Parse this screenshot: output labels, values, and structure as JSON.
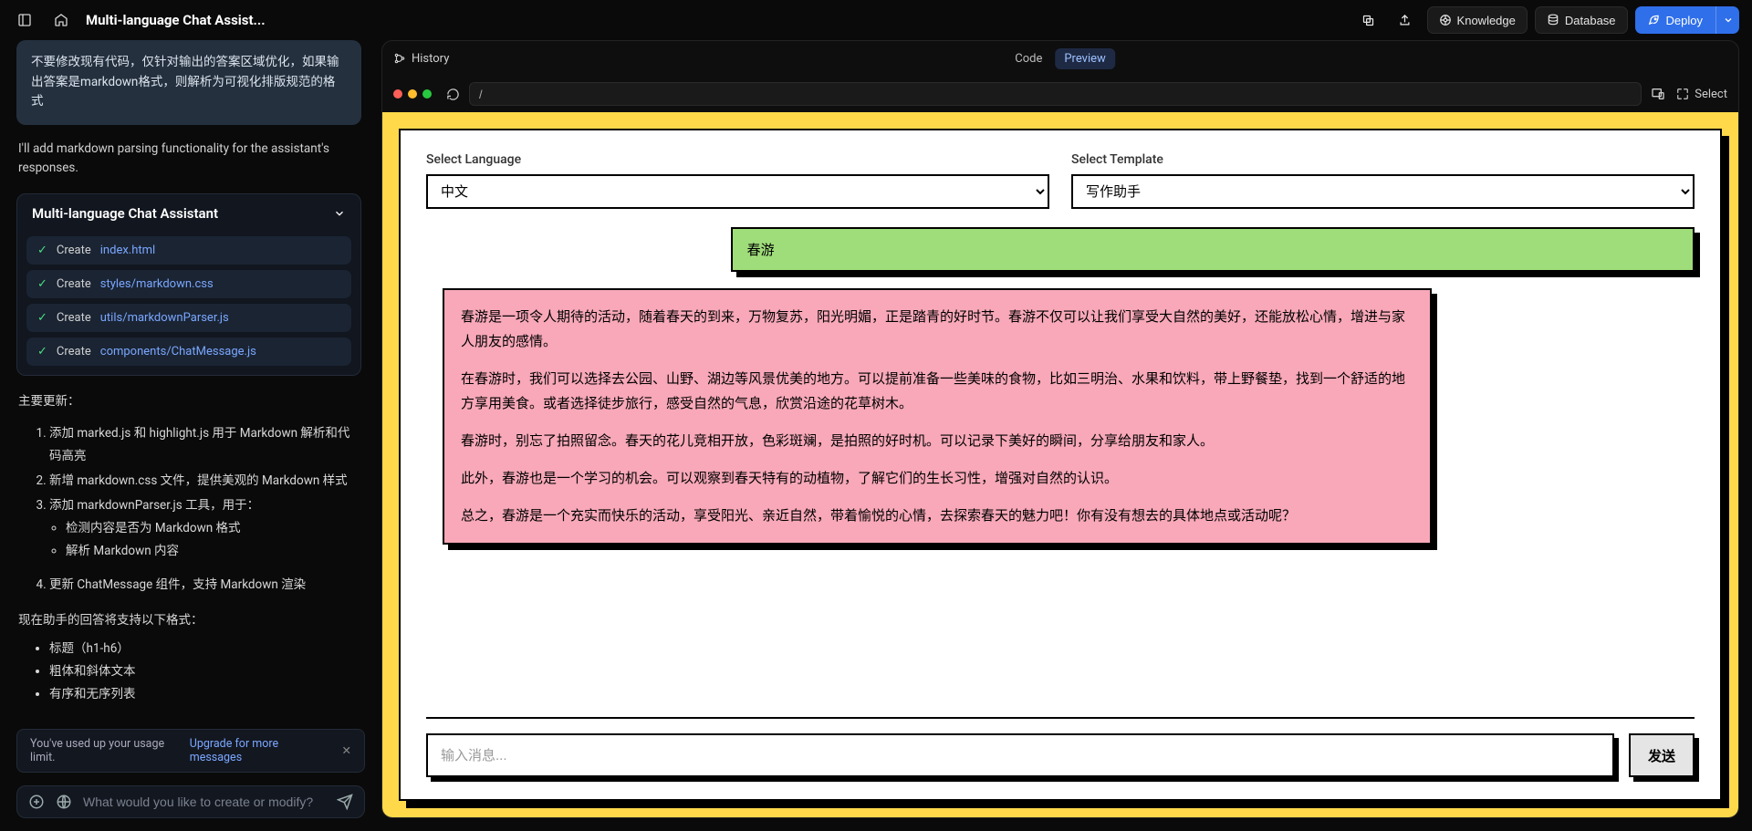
{
  "header": {
    "title": "Multi-language Chat Assist...",
    "knowledge": "Knowledge",
    "database": "Database",
    "deploy": "Deploy"
  },
  "sidebar": {
    "user_message": "不要修改现有代码，仅针对输出的答案区域优化，如果输出答案是markdown格式，则解析为可视化排版规范的格式",
    "assistant_intro": "I'll add markdown parsing functionality for the assistant's responses.",
    "tool_panel_title": "Multi-language Chat Assistant",
    "tool_items": [
      {
        "action": "Create",
        "file": "index.html"
      },
      {
        "action": "Create",
        "file": "styles/markdown.css"
      },
      {
        "action": "Create",
        "file": "utils/markdownParser.js"
      },
      {
        "action": "Create",
        "file": "components/ChatMessage.js"
      }
    ],
    "updates_heading": "主要更新：",
    "updates_ol": [
      "添加 marked.js 和 highlight.js 用于 Markdown 解析和代码高亮",
      "新增 markdown.css 文件，提供美观的 Markdown 样式",
      "添加 markdownParser.js 工具，用于："
    ],
    "updates_sub": [
      "检测内容是否为 Markdown 格式",
      "解析 Markdown 内容"
    ],
    "updates_ol_4": "更新 ChatMessage 组件，支持 Markdown 渲染",
    "now_supports": "现在助手的回答将支持以下格式：",
    "formats": [
      "标题（h1-h6）",
      "粗体和斜体文本",
      "有序和无序列表"
    ],
    "usage_text": "You've used up your usage limit.",
    "usage_link": "Upgrade for more messages",
    "prompt_placeholder": "What would you like to create or modify?"
  },
  "frame": {
    "history": "History",
    "tab_code": "Code",
    "tab_preview": "Preview",
    "url": "/",
    "select": "Select"
  },
  "app": {
    "label_language": "Select Language",
    "label_template": "Select Template",
    "language_value": "中文",
    "template_value": "写作助手",
    "user_msg": "春游",
    "assistant_paras": [
      "春游是一项令人期待的活动，随着春天的到来，万物复苏，阳光明媚，正是踏青的好时节。春游不仅可以让我们享受大自然的美好，还能放松心情，增进与家人朋友的感情。",
      "在春游时，我们可以选择去公园、山野、湖边等风景优美的地方。可以提前准备一些美味的食物，比如三明治、水果和饮料，带上野餐垫，找到一个舒适的地方享用美食。或者选择徒步旅行，感受自然的气息，欣赏沿途的花草树木。",
      "春游时，别忘了拍照留念。春天的花儿竞相开放，色彩斑斓，是拍照的好时机。可以记录下美好的瞬间，分享给朋友和家人。",
      "此外，春游也是一个学习的机会。可以观察到春天特有的动植物，了解它们的生长习性，增强对自然的认识。",
      "总之，春游是一个充实而快乐的活动，享受阳光、亲近自然，带着愉悦的心情，去探索春天的魅力吧！你有没有想去的具体地点或活动呢？"
    ],
    "input_placeholder": "输入消息...",
    "send": "发送"
  }
}
